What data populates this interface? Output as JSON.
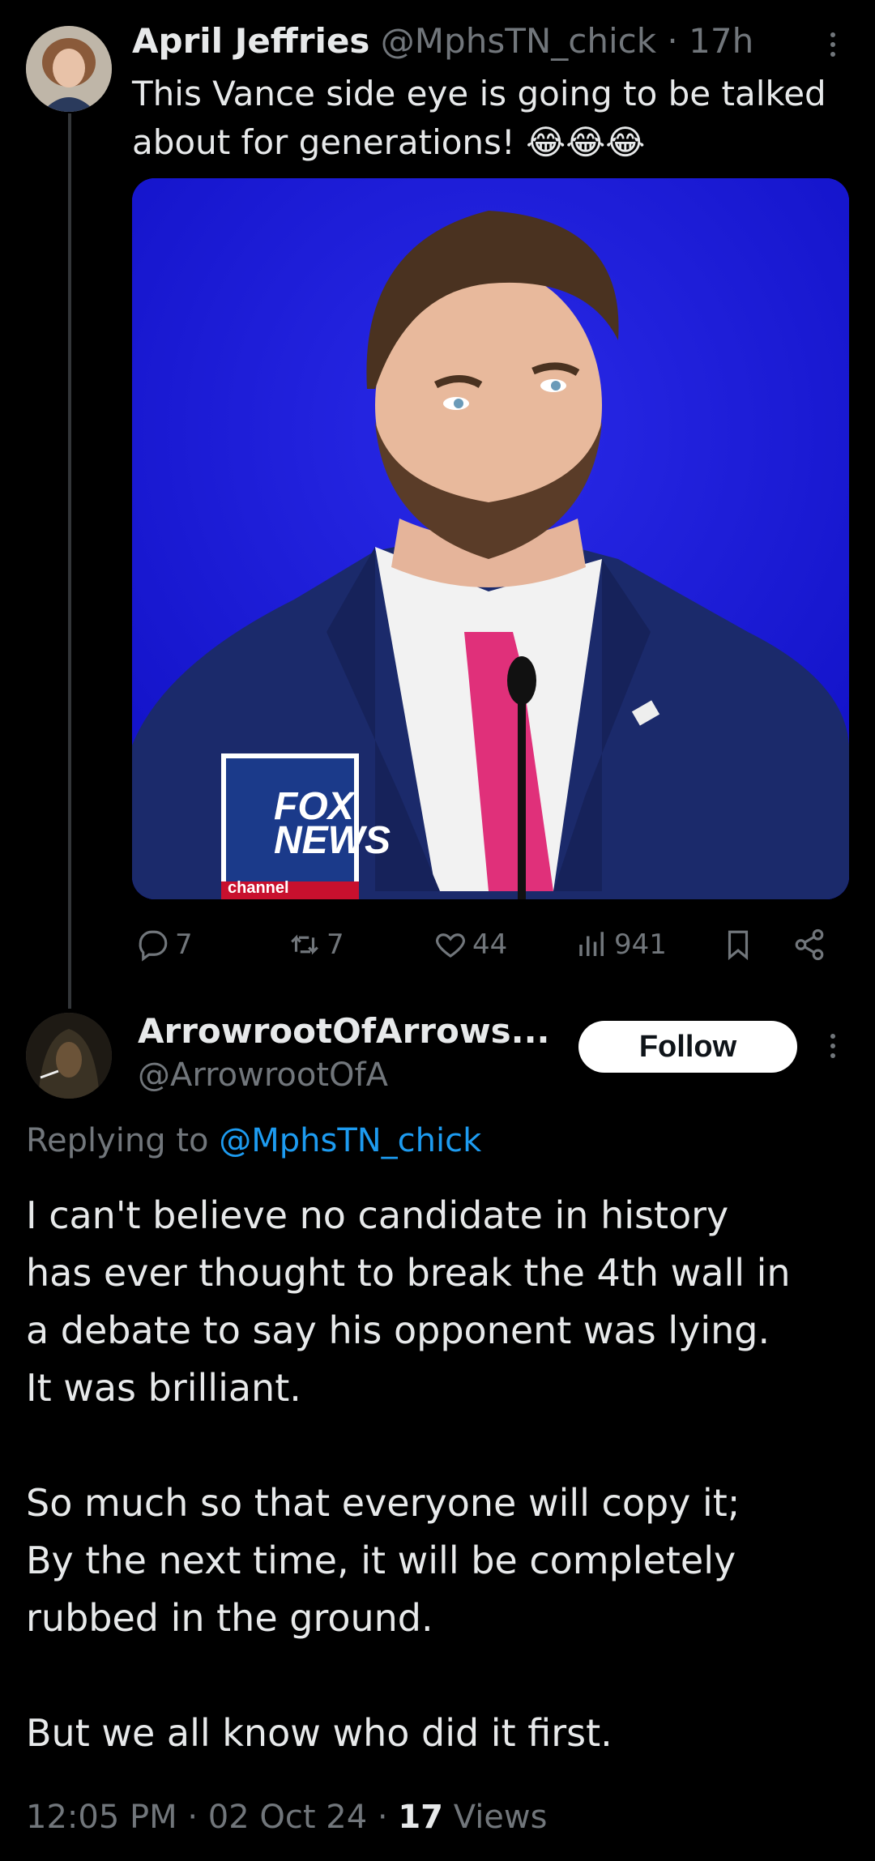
{
  "original_tweet": {
    "author_name": "April Jeffries",
    "handle": "@MphsTN_chick",
    "time": "· 17h",
    "text_line1": "This Vance side eye is going to be talked",
    "text_line2": "about for generations!",
    "emoji": "😂😂😂",
    "image_logo_line1": "FOX",
    "image_logo_line2": "NEWS",
    "image_logo_line3": "channel",
    "replies": "7",
    "retweets": "7",
    "likes": "44",
    "views": "941"
  },
  "reply_tweet": {
    "author_name": "ArrowrootOfArrows...",
    "handle": "@ArrowrootOfA",
    "follow_label": "Follow",
    "replying_to_prefix": "Replying to",
    "replying_to_handle": "@MphsTN_chick",
    "body_lines": [
      "I can't believe no candidate in history",
      "has ever thought to break the 4th wall in",
      "a debate to say his opponent was lying.",
      "It was brilliant.",
      "So much so that everyone will copy it;",
      "By the next time, it will be completely",
      "rubbed in the ground.",
      "But we all know who did it first."
    ],
    "timestamp": "12:05 PM · 02 Oct 24 ·",
    "views_count": "17",
    "views_label": "Views"
  },
  "colors": {
    "background": "#000000",
    "text": "#e7e9ea",
    "muted": "#71767b",
    "link": "#1d9bf0",
    "image_bg": "#1a1ae6"
  }
}
